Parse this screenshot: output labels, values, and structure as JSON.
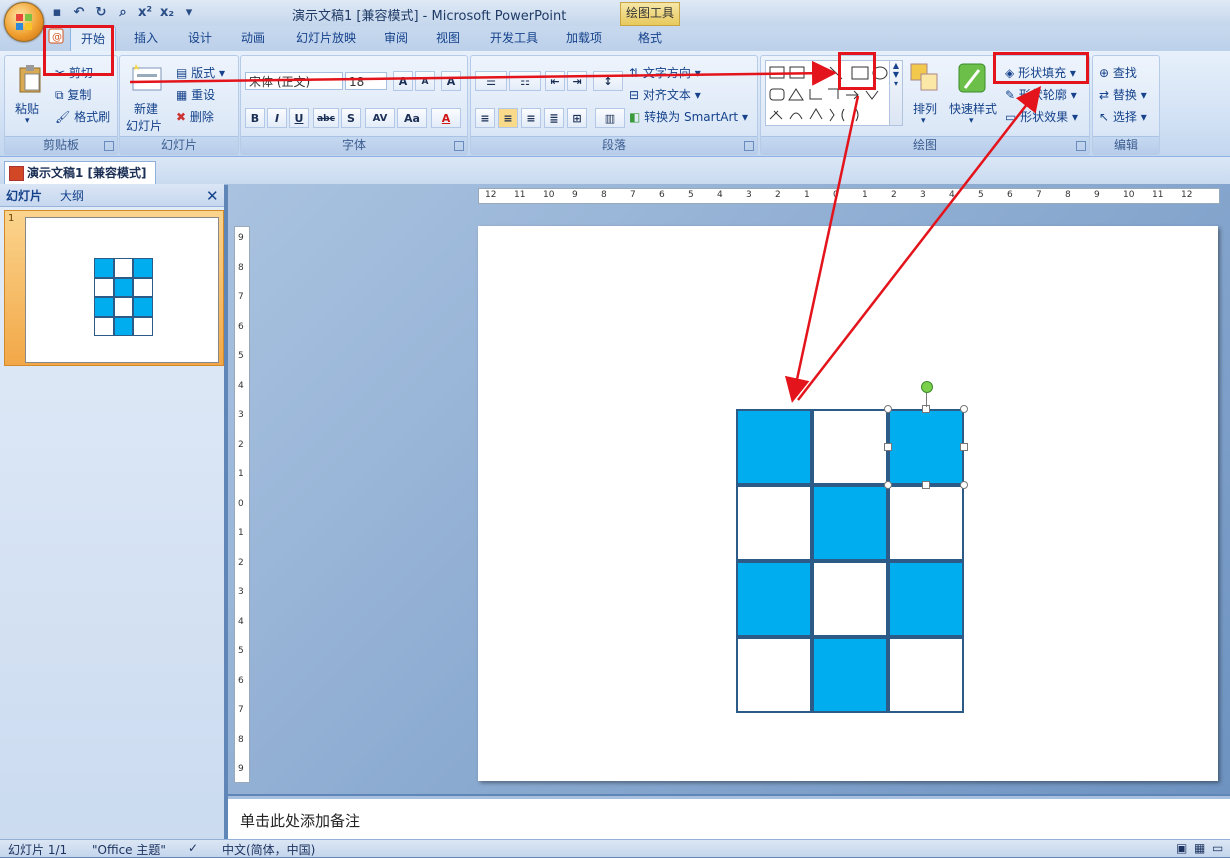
{
  "window": {
    "title": "演示文稿1 [兼容模式] - Microsoft PowerPoint",
    "contextual_tab": "绘图工具"
  },
  "tabs": [
    {
      "label": "开始",
      "active": true
    },
    {
      "label": "插入"
    },
    {
      "label": "设计"
    },
    {
      "label": "动画"
    },
    {
      "label": "幻灯片放映"
    },
    {
      "label": "审阅"
    },
    {
      "label": "视图"
    },
    {
      "label": "开发工具"
    },
    {
      "label": "加载项"
    },
    {
      "label": "格式"
    }
  ],
  "ribbon": {
    "clipboard": {
      "label": "剪贴板",
      "paste": "粘贴",
      "cut": "剪切",
      "copy": "复制",
      "format_painter": "格式刷"
    },
    "slides": {
      "label": "幻灯片",
      "new_slide_line1": "新建",
      "new_slide_line2": "幻灯片",
      "layout": "版式",
      "reset": "重设",
      "delete": "删除"
    },
    "font": {
      "label": "字体",
      "font_name": "宋体 (正文)",
      "font_size": "18",
      "grow": "A",
      "shrink": "A",
      "clear": "A",
      "bold": "B",
      "italic": "I",
      "underline": "U",
      "strike": "abc",
      "shadow": "S",
      "spacing": "AV",
      "case": "Aa",
      "color": "A"
    },
    "paragraph": {
      "label": "段落",
      "text_direction": "文字方向",
      "align_text": "对齐文本",
      "smartart": "转换为 SmartArt"
    },
    "drawing": {
      "label": "绘图",
      "arrange": "排列",
      "quick_styles": "快速样式",
      "shape_fill": "形状填充",
      "shape_outline": "形状轮廓",
      "shape_effects": "形状效果"
    },
    "editing": {
      "label": "编辑",
      "find": "查找",
      "replace": "替换",
      "select": "选择"
    }
  },
  "document_tab": "演示文稿1 [兼容模式]",
  "left_pane": {
    "tab_slides": "幻灯片",
    "tab_outline": "大纲",
    "slide_number": "1"
  },
  "ruler": {
    "horizontal": [
      "12",
      "11",
      "10",
      "9",
      "8",
      "7",
      "6",
      "5",
      "4",
      "3",
      "2",
      "1",
      "0",
      "1",
      "2",
      "3",
      "4",
      "5",
      "6",
      "7",
      "8",
      "9",
      "10",
      "11",
      "12"
    ],
    "vertical": [
      "9",
      "8",
      "7",
      "6",
      "5",
      "4",
      "3",
      "2",
      "1",
      "0",
      "1",
      "2",
      "3",
      "4",
      "5",
      "6",
      "7",
      "8",
      "9"
    ]
  },
  "grid": {
    "rows": [
      [
        "blue",
        "white",
        "blue"
      ],
      [
        "white",
        "blue",
        "white"
      ],
      [
        "blue",
        "white",
        "blue"
      ],
      [
        "white",
        "blue",
        "white"
      ]
    ],
    "fill_color": "#00adef",
    "outline_color": "#2d5b88"
  },
  "notes": {
    "placeholder": "单击此处添加备注"
  },
  "status": {
    "slide": "幻灯片 1/1",
    "theme": "\"Office 主题\"",
    "language": "中文(简体，中国)"
  }
}
